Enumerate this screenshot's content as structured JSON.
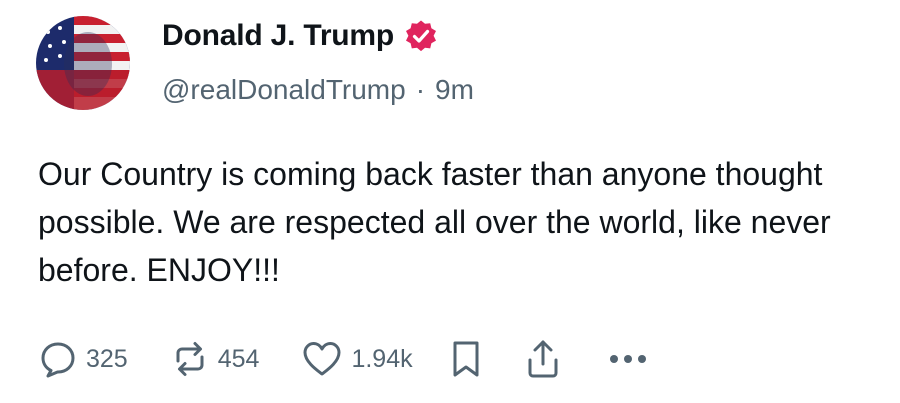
{
  "author": {
    "display_name": "Donald J. Trump",
    "handle": "@realDonaldTrump",
    "separator": "·",
    "time_ago": "9m",
    "verified_color": "#e0245e"
  },
  "post": {
    "text": "Our Country is coming back faster than anyone thought possible. We are respected all over the world, like never before. ENJOY!!!"
  },
  "actions": {
    "replies": "325",
    "reposts": "454",
    "likes": "1.94k",
    "icons": [
      "reply-icon",
      "repost-icon",
      "like-icon",
      "bookmark-icon",
      "share-icon",
      "more-icon"
    ]
  },
  "colors": {
    "text": "#0f1419",
    "muted": "#536471",
    "icon": "#536471"
  }
}
